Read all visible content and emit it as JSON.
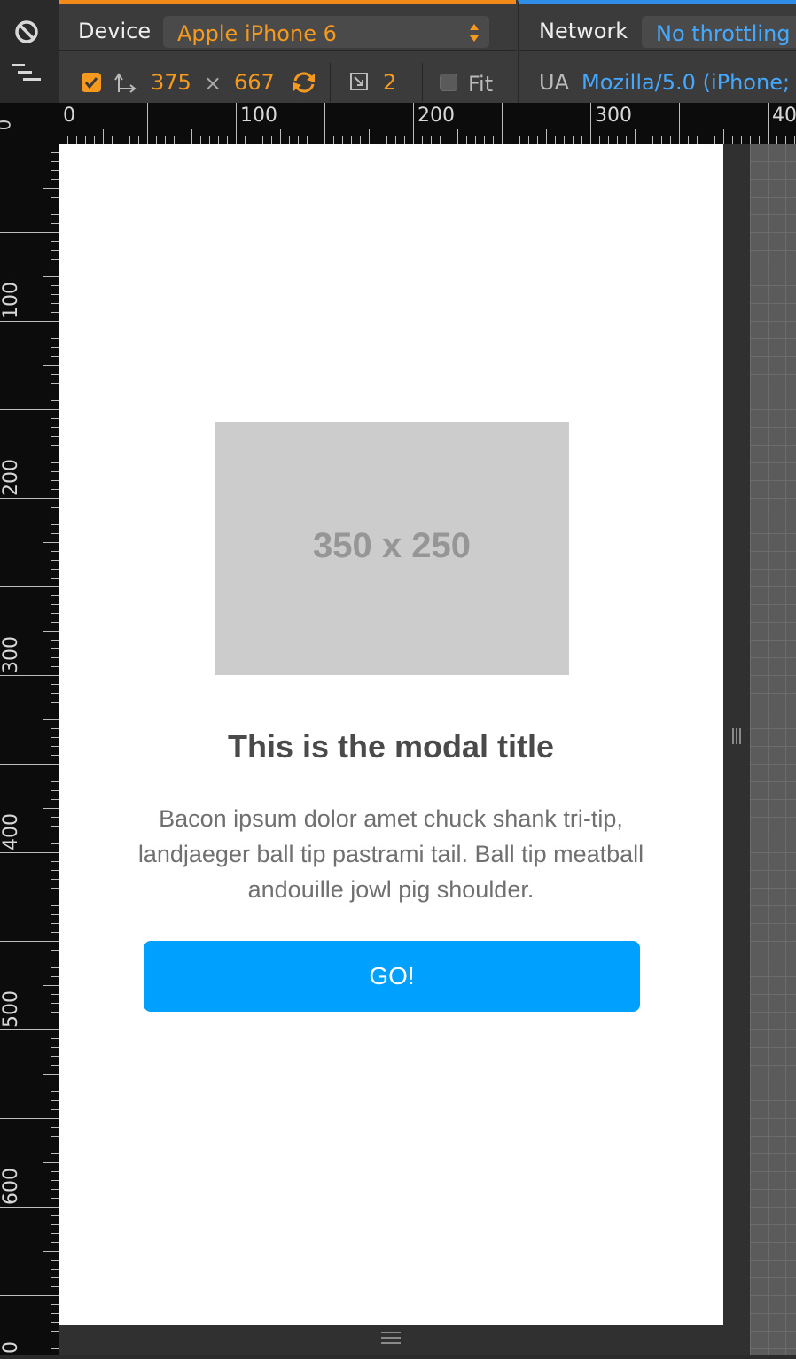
{
  "toolbar": {
    "device_label": "Device",
    "device_selected": "Apple iPhone 6",
    "width": "375",
    "times": "×",
    "height": "667",
    "dpr": "2",
    "fit_label": "Fit",
    "network_label": "Network",
    "throttling_selected": "No throttling",
    "ua_label": "UA",
    "ua_value": "Mozilla/5.0 (iPhone;",
    "colors": {
      "orange": "#f59a1e",
      "blue": "#45a8ff"
    }
  },
  "rulers": {
    "horizontal": [
      "0",
      "100",
      "200",
      "300",
      "40"
    ],
    "vertical": [
      "100",
      "200",
      "300",
      "400",
      "500",
      "600",
      "0"
    ],
    "corner": "0"
  },
  "page": {
    "placeholder_text": "350 x 250",
    "modal_title": "This is the modal title",
    "modal_body": "Bacon ipsum dolor amet chuck shank tri-tip, landjaeger ball tip pastrami tail. Ball tip meatball andouille jowl pig shoulder.",
    "button_label": "GO!",
    "colors": {
      "button": "#00a0ff",
      "placeholder_bg": "#cccccc"
    }
  }
}
